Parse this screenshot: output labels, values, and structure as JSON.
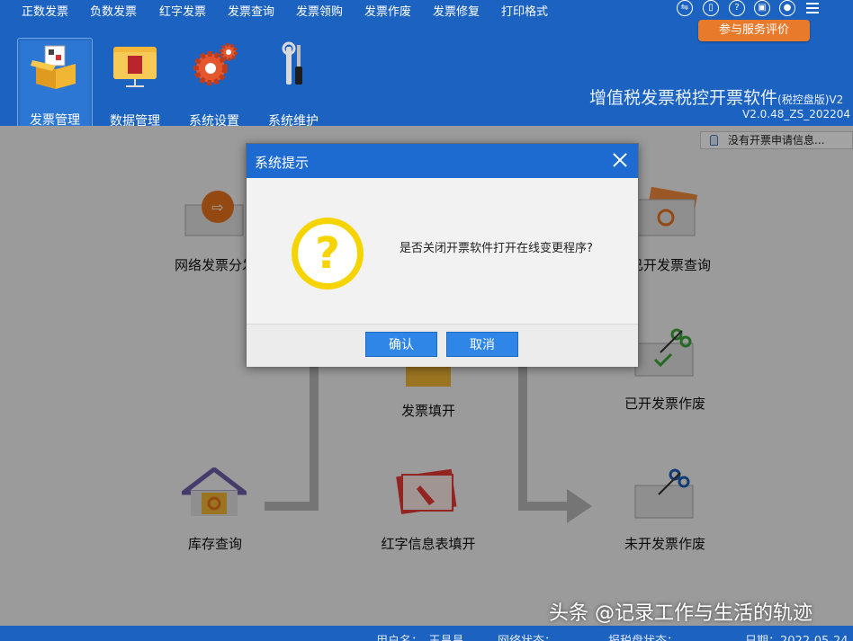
{
  "menu": {
    "items": [
      "正数发票",
      "负数发票",
      "红字发票",
      "发票查询",
      "发票领购",
      "发票作废",
      "发票修复",
      "打印格式"
    ]
  },
  "service_button": "参与服务评价",
  "toolbar": {
    "items": [
      {
        "label": "发票管理",
        "icon": "invoice-box-icon",
        "active": true
      },
      {
        "label": "数据管理",
        "icon": "folder-icon",
        "active": false
      },
      {
        "label": "系统设置",
        "icon": "gear-icon",
        "active": false
      },
      {
        "label": "系统维护",
        "icon": "wrench-screwdriver-icon",
        "active": false
      }
    ]
  },
  "app": {
    "title": "增值税发票税控开票软件",
    "title_sub": "(税控盘版)V2",
    "version": "V2.0.48_ZS_202204"
  },
  "notice": "没有开票申请信息...",
  "features": [
    {
      "label": "网络发票分发",
      "icon": "network-invoice-icon"
    },
    {
      "label": "已开发票查询",
      "icon": "issued-invoice-query-icon"
    },
    {
      "label": "发票填开",
      "icon": "invoice-fill-icon"
    },
    {
      "label": "已开发票作废",
      "icon": "issued-invoice-void-icon"
    },
    {
      "label": "库存查询",
      "icon": "inventory-query-icon"
    },
    {
      "label": "红字信息表填开",
      "icon": "red-invoice-info-icon"
    },
    {
      "label": "未开发票作废",
      "icon": "unissued-invoice-void-icon"
    }
  ],
  "dialog": {
    "title": "系统提示",
    "message": "是否关闭开票软件打开在线变更程序?",
    "confirm": "确认",
    "cancel": "取消"
  },
  "status": {
    "user": "用户名：　王昌昌",
    "network": "网络状态：",
    "taxdisk": "报税盘状态：",
    "date": "日期：2022-05-24"
  },
  "watermark": "头条 @记录工作与生活的轨迹",
  "colors": {
    "brand_blue": "#1c62c0",
    "service_orange": "#e87a2c",
    "dialog_button": "#2f86e6",
    "question_yellow": "#f6d400"
  }
}
